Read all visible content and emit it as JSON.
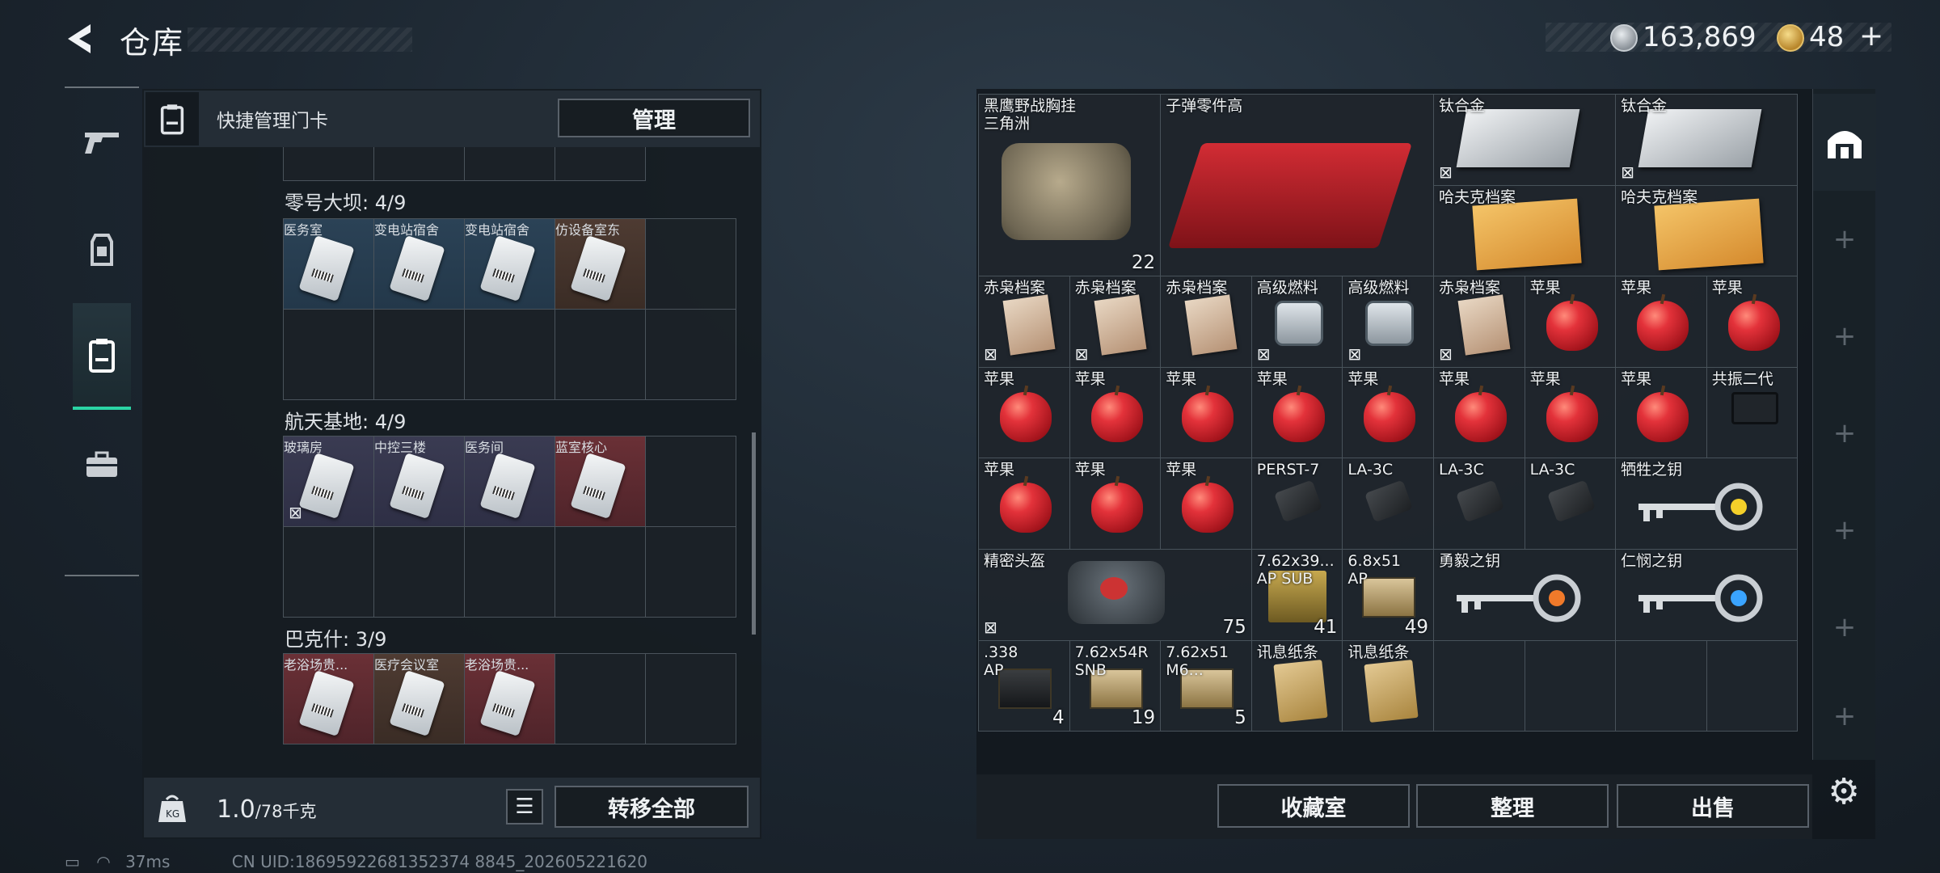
{
  "header": {
    "title": "仓库",
    "money": "163,869",
    "tickets": "48"
  },
  "left_panel": {
    "title": "快捷管理门卡",
    "manage_label": "管理",
    "sections": [
      {
        "name": "零号大坝: 4/9",
        "cards": [
          {
            "name": "医务室",
            "color": "blue"
          },
          {
            "name": "变电站宿舍",
            "color": "blue"
          },
          {
            "name": "变电站宿舍",
            "color": "blue"
          },
          {
            "name": "仿设备室东",
            "color": "brown"
          }
        ]
      },
      {
        "name": "航天基地: 4/9",
        "cards": [
          {
            "name": "玻璃房",
            "color": "purple",
            "nolock": true
          },
          {
            "name": "中控三楼",
            "color": "purple"
          },
          {
            "name": "医务间",
            "color": "purple"
          },
          {
            "name": "蓝室核心",
            "color": "red"
          }
        ]
      },
      {
        "name": "巴克什: 3/9",
        "cards": [
          {
            "name": "老浴场贵...",
            "color": "red"
          },
          {
            "name": "医疗会议室",
            "color": "brown"
          },
          {
            "name": "老浴场贵...",
            "color": "red"
          }
        ]
      }
    ],
    "weight": "1.0",
    "weight_cap": "/78千克",
    "transfer_label": "转移全部"
  },
  "status": {
    "ping": "37ms",
    "uid": "CN UID:18695922681352374 8845_202605221620"
  },
  "stash": {
    "bottom_buttons": [
      "收藏室",
      "整理",
      "出售"
    ],
    "items": [
      {
        "name": "黑鹰野战胸挂\n三角洲",
        "col": 1,
        "row": 1,
        "w": 2,
        "h": 2,
        "bg": "brown",
        "art": "bag",
        "count": "22"
      },
      {
        "name": "子弹零件高",
        "col": 3,
        "row": 1,
        "w": 3,
        "h": 2,
        "bg": "brown",
        "art": "tray"
      },
      {
        "name": "钛合金",
        "col": 6,
        "row": 1,
        "w": 2,
        "h": 1,
        "bg": "purple",
        "art": "plate",
        "nolock": true
      },
      {
        "name": "钛合金",
        "col": 8,
        "row": 1,
        "w": 2,
        "h": 1,
        "bg": "purple",
        "art": "plate",
        "nolock": true
      },
      {
        "name": "哈夫克档案",
        "col": 6,
        "row": 2,
        "w": 2,
        "h": 1,
        "bg": "brown",
        "art": "docbig"
      },
      {
        "name": "哈夫克档案",
        "col": 8,
        "row": 2,
        "w": 2,
        "h": 1,
        "bg": "brown",
        "art": "docbig"
      },
      {
        "name": "赤枭档案",
        "col": 1,
        "row": 3,
        "w": 1,
        "h": 1,
        "bg": "brown",
        "art": "folder",
        "nolock": true
      },
      {
        "name": "赤枭档案",
        "col": 2,
        "row": 3,
        "w": 1,
        "h": 1,
        "bg": "brown",
        "art": "folder",
        "nolock": true
      },
      {
        "name": "赤枭档案",
        "col": 3,
        "row": 3,
        "w": 1,
        "h": 1,
        "bg": "brown",
        "art": "folder"
      },
      {
        "name": "高级燃料",
        "col": 4,
        "row": 3,
        "w": 1,
        "h": 1,
        "bg": "purple",
        "art": "fuel",
        "nolock": true
      },
      {
        "name": "高级燃料",
        "col": 5,
        "row": 3,
        "w": 1,
        "h": 1,
        "bg": "purple",
        "art": "fuel",
        "nolock": true
      },
      {
        "name": "赤枭档案",
        "col": 6,
        "row": 3,
        "w": 1,
        "h": 1,
        "bg": "brown",
        "art": "folder",
        "nolock": true
      },
      {
        "name": "苹果",
        "col": 7,
        "row": 3,
        "w": 1,
        "h": 1,
        "bg": "green",
        "art": "apple"
      },
      {
        "name": "苹果",
        "col": 8,
        "row": 3,
        "w": 1,
        "h": 1,
        "bg": "green",
        "art": "apple"
      },
      {
        "name": "苹果",
        "col": 9,
        "row": 3,
        "w": 1,
        "h": 1,
        "bg": "green",
        "art": "apple"
      },
      {
        "name": "苹果",
        "col": 1,
        "row": 4,
        "w": 1,
        "h": 1,
        "bg": "green",
        "art": "apple"
      },
      {
        "name": "苹果",
        "col": 2,
        "row": 4,
        "w": 1,
        "h": 1,
        "bg": "green",
        "art": "apple"
      },
      {
        "name": "苹果",
        "col": 3,
        "row": 4,
        "w": 1,
        "h": 1,
        "bg": "green",
        "art": "apple"
      },
      {
        "name": "苹果",
        "col": 4,
        "row": 4,
        "w": 1,
        "h": 1,
        "bg": "green",
        "art": "apple"
      },
      {
        "name": "苹果",
        "col": 5,
        "row": 4,
        "w": 1,
        "h": 1,
        "bg": "green",
        "art": "apple"
      },
      {
        "name": "苹果",
        "col": 6,
        "row": 4,
        "w": 1,
        "h": 1,
        "bg": "green",
        "art": "apple"
      },
      {
        "name": "苹果",
        "col": 7,
        "row": 4,
        "w": 1,
        "h": 1,
        "bg": "green",
        "art": "apple"
      },
      {
        "name": "苹果",
        "col": 8,
        "row": 4,
        "w": 1,
        "h": 1,
        "bg": "green",
        "art": "apple"
      },
      {
        "name": "共振二代",
        "col": 9,
        "row": 4,
        "w": 1,
        "h": 1,
        "bg": "purple",
        "art": "vest"
      },
      {
        "name": "苹果",
        "col": 1,
        "row": 5,
        "w": 1,
        "h": 1,
        "bg": "green",
        "art": "apple"
      },
      {
        "name": "苹果",
        "col": 2,
        "row": 5,
        "w": 1,
        "h": 1,
        "bg": "green",
        "art": "apple"
      },
      {
        "name": "苹果",
        "col": 3,
        "row": 5,
        "w": 1,
        "h": 1,
        "bg": "green",
        "art": "apple"
      },
      {
        "name": "PERST-7",
        "col": 4,
        "row": 5,
        "w": 1,
        "h": 1,
        "bg": "purple",
        "art": "scope"
      },
      {
        "name": "LA-3C",
        "col": 5,
        "row": 5,
        "w": 1,
        "h": 1,
        "bg": "purple",
        "art": "scope"
      },
      {
        "name": "LA-3C",
        "col": 6,
        "row": 5,
        "w": 1,
        "h": 1,
        "bg": "purple",
        "art": "scope"
      },
      {
        "name": "LA-3C",
        "col": 7,
        "row": 5,
        "w": 1,
        "h": 1,
        "bg": "purple",
        "art": "scope"
      },
      {
        "name": "牺牲之钥",
        "col": 8,
        "row": 5,
        "w": 2,
        "h": 1,
        "bg": "brown",
        "art": "key",
        "gem": "#f4d02a"
      },
      {
        "name": "精密头盔",
        "col": 1,
        "row": 6,
        "w": 3,
        "h": 1,
        "bg": "brown",
        "art": "helmet",
        "nolock": true,
        "count": "75"
      },
      {
        "name": "7.62x39...\nAP SUB",
        "col": 4,
        "row": 6,
        "w": 1,
        "h": 1,
        "bg": "brown",
        "art": "ammocases",
        "count": "41"
      },
      {
        "name": "6.8x51\nAP",
        "col": 5,
        "row": 6,
        "w": 1,
        "h": 1,
        "bg": "red",
        "art": "boxammo",
        "count": "49"
      },
      {
        "name": "勇毅之钥",
        "col": 6,
        "row": 6,
        "w": 2,
        "h": 1,
        "bg": "brown",
        "art": "key",
        "gem": "#f07a2a"
      },
      {
        "name": "仁悯之钥",
        "col": 8,
        "row": 6,
        "w": 2,
        "h": 1,
        "bg": "purple",
        "art": "key",
        "gem": "#3aa4ff"
      },
      {
        "name": ".338\nAP",
        "col": 1,
        "row": 7,
        "w": 1,
        "h": 1,
        "bg": "red",
        "art": "boxdark",
        "count": "4"
      },
      {
        "name": "7.62x54R\nSNB",
        "col": 2,
        "row": 7,
        "w": 1,
        "h": 1,
        "bg": "red",
        "art": "boxammo",
        "count": "19"
      },
      {
        "name": "7.62x51\nM6...",
        "col": 3,
        "row": 7,
        "w": 1,
        "h": 1,
        "bg": "red",
        "art": "boxammo",
        "count": "5"
      },
      {
        "name": "讯息纸条",
        "col": 4,
        "row": 7,
        "w": 1,
        "h": 1,
        "bg": "red",
        "art": "note"
      },
      {
        "name": "讯息纸条",
        "col": 5,
        "row": 7,
        "w": 1,
        "h": 1,
        "bg": "red",
        "art": "note"
      }
    ]
  },
  "icons": {
    "back": "back-arrow-icon",
    "coin": "silver-coin-icon",
    "ticket": "gold-ticket-icon",
    "settings": "gear-icon"
  }
}
